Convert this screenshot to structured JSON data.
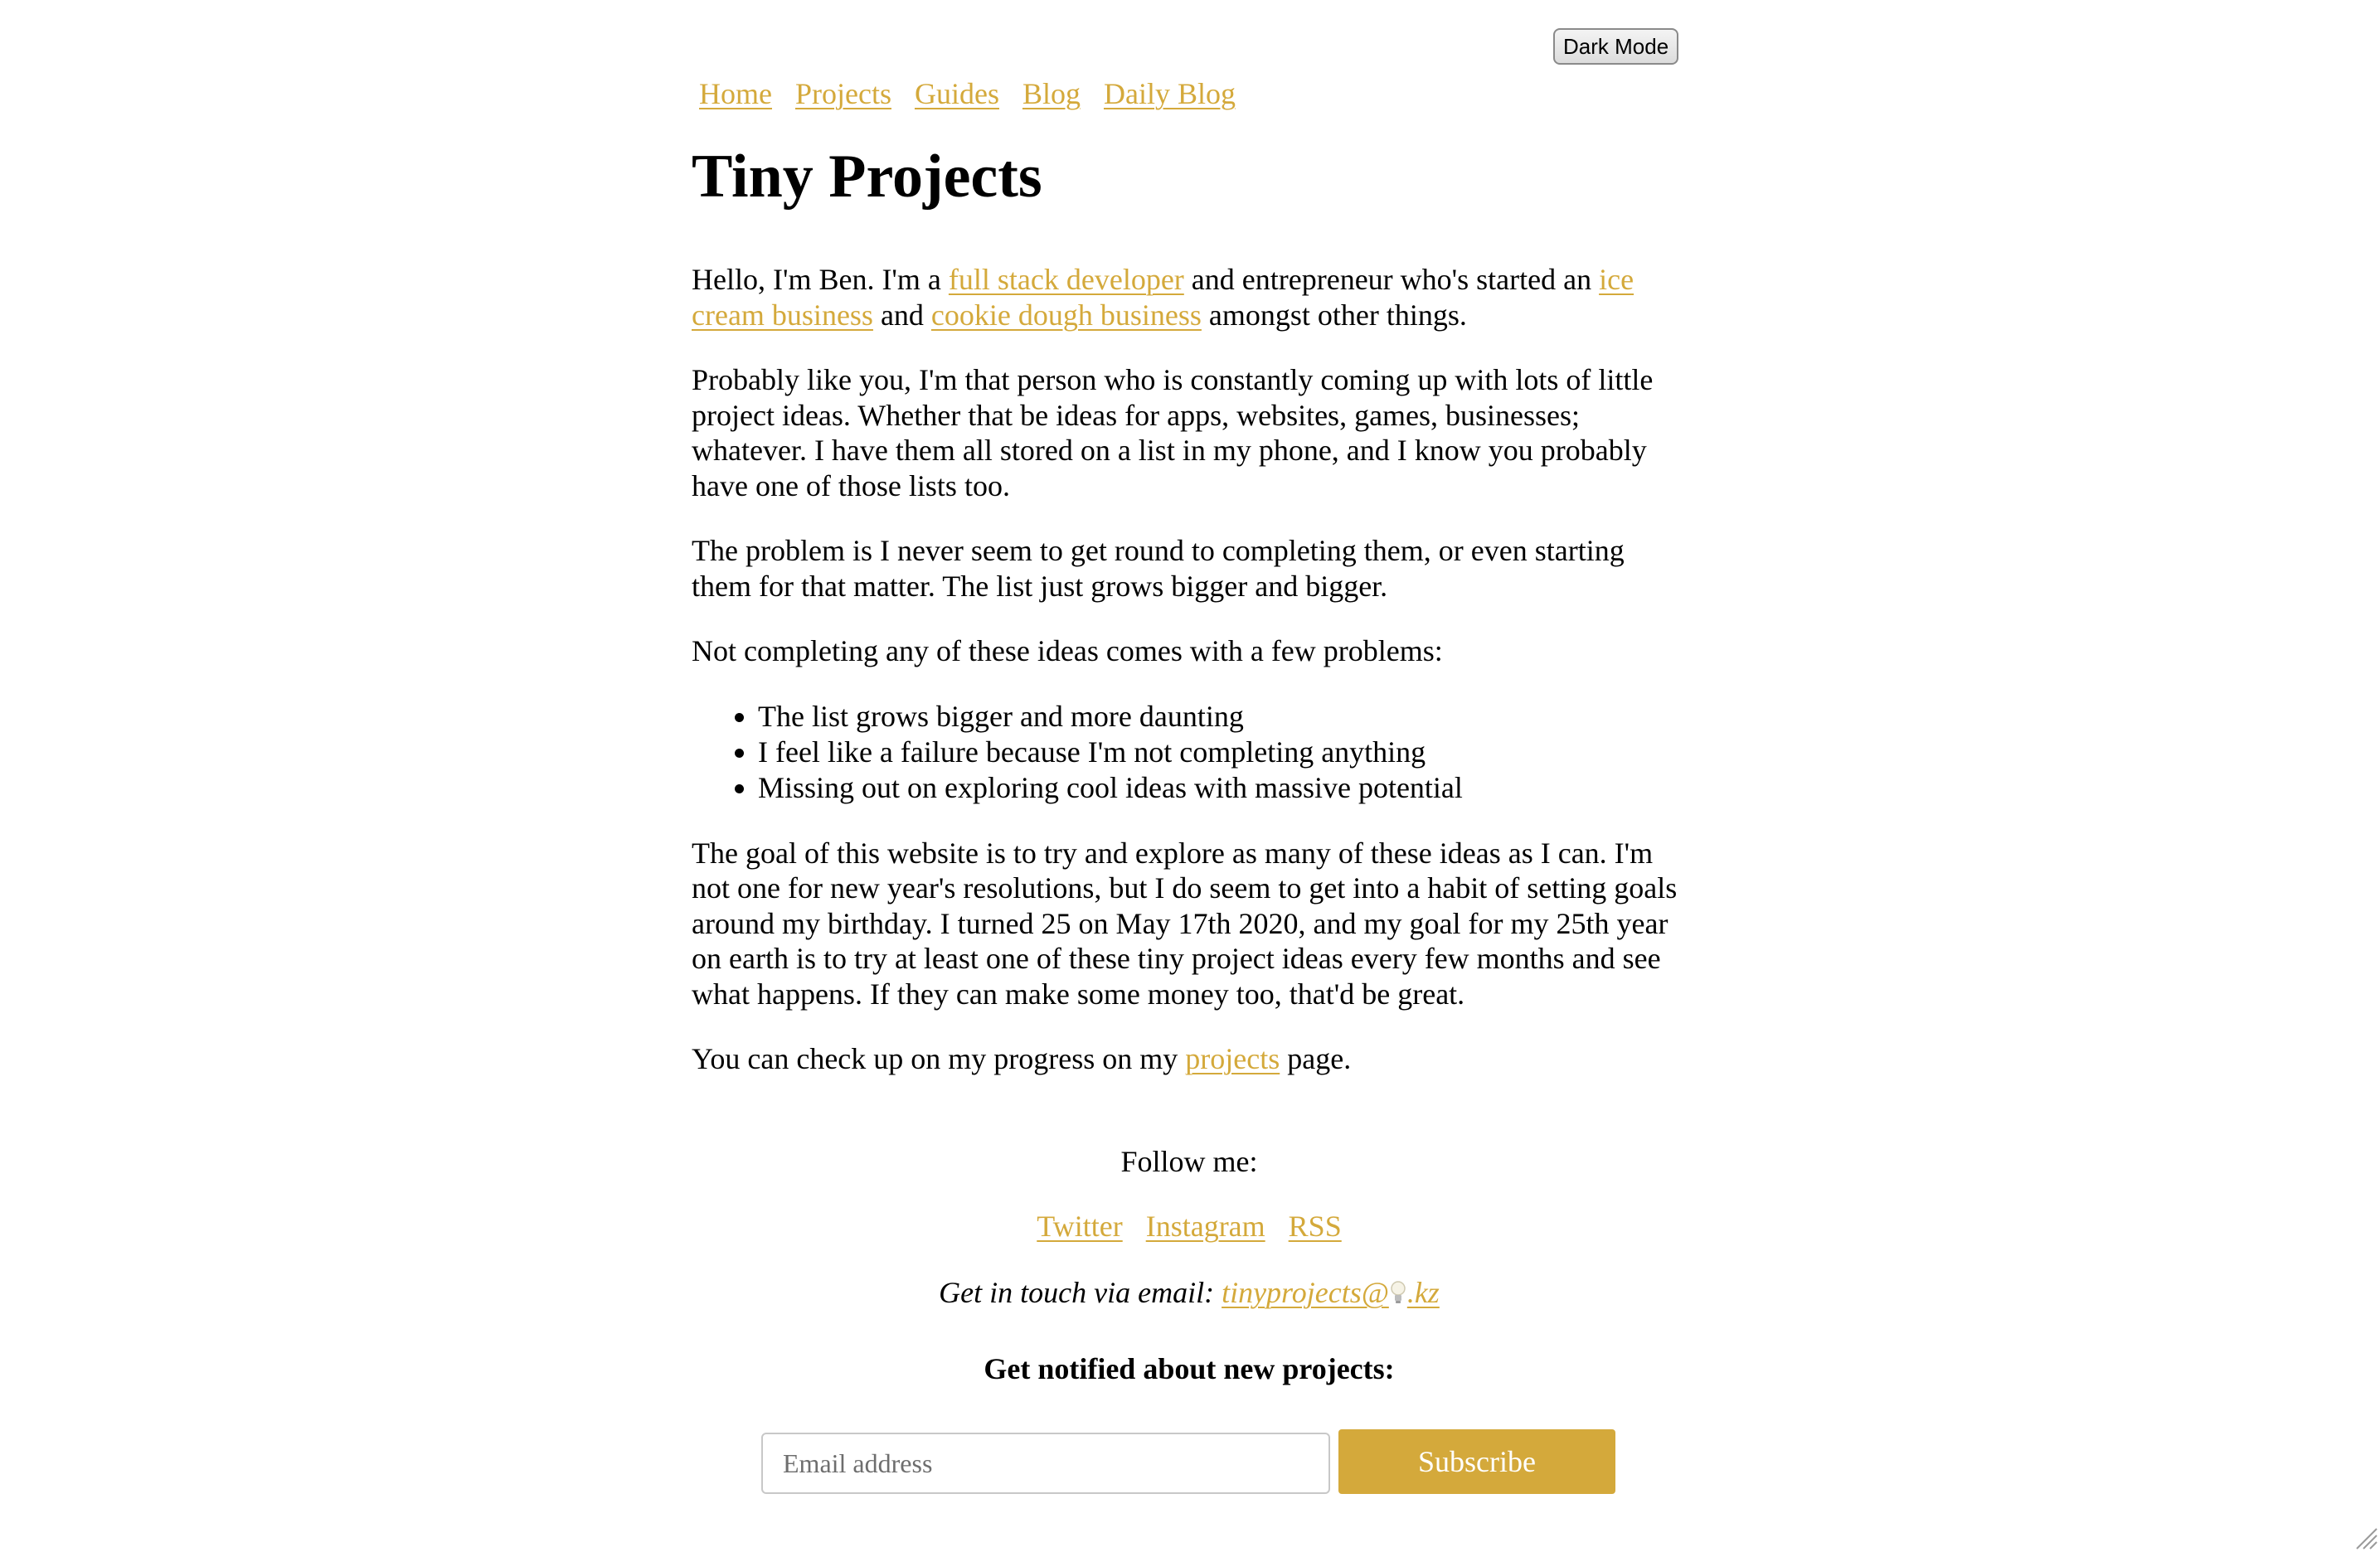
{
  "toolbar": {
    "dark_mode_label": "Dark Mode"
  },
  "nav": {
    "items": [
      {
        "label": "Home"
      },
      {
        "label": "Projects"
      },
      {
        "label": "Guides"
      },
      {
        "label": "Blog"
      },
      {
        "label": "Daily Blog"
      }
    ]
  },
  "page": {
    "title": "Tiny Projects"
  },
  "intro": {
    "t1": "Hello, I'm Ben. I'm a ",
    "link_fullstack": "full stack developer",
    "t2": " and entrepreneur who's started an ",
    "link_icecream": "ice cream business",
    "t3": " and ",
    "link_cookie": "cookie dough business",
    "t4": " amongst other things."
  },
  "paragraphs": {
    "p2": "Probably like you, I'm that person who is constantly coming up with lots of little project ideas. Whether that be ideas for apps, websites, games, businesses; whatever. I have them all stored on a list in my phone, and I know you probably have one of those lists too.",
    "p3": "The problem is I never seem to get round to completing them, or even starting them for that matter. The list just grows bigger and bigger.",
    "p4": "Not completing any of these ideas comes with a few problems:",
    "p5": "The goal of this website is to try and explore as many of these ideas as I can. I'm not one for new year's resolutions, but I do seem to get into a habit of setting goals around my birthday. I turned 25 on May 17th 2020, and my goal for my 25th year on earth is to try at least one of these tiny project ideas every few months and see what happens. If they can make some money too, that'd be great."
  },
  "problems": [
    "The list grows bigger and more daunting",
    "I feel like a failure because I'm not completing anything",
    "Missing out on exploring cool ideas with massive potential"
  ],
  "progress": {
    "t1": "You can check up on my progress on my ",
    "link_projects": "projects",
    "t2": " page."
  },
  "footer": {
    "follow_label": "Follow me:",
    "social": [
      {
        "label": "Twitter"
      },
      {
        "label": "Instagram"
      },
      {
        "label": "RSS"
      }
    ],
    "contact_label": "Get in touch via email: ",
    "email_prefix": "tinyprojects@",
    "email_icon": "lightbulb-icon",
    "email_suffix": ".kz",
    "notify_heading": "Get notified about new projects:",
    "email_placeholder": "Email address",
    "subscribe_label": "Subscribe"
  },
  "colors": {
    "accent": "#d4a93b",
    "text": "#000000",
    "background": "#ffffff"
  }
}
